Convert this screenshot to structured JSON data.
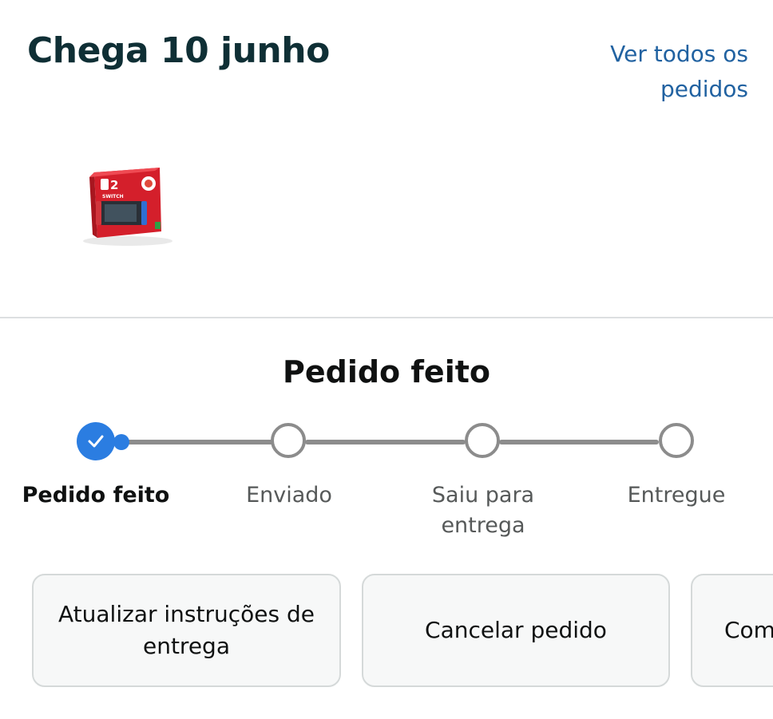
{
  "header": {
    "arrival_title": "Chega 10 junho",
    "view_all_orders": "Ver todos os pedidos"
  },
  "product": {
    "badge_text": "2",
    "brand_text": "SWITCH"
  },
  "status": {
    "title": "Pedido feito",
    "steps": [
      {
        "label": "Pedido feito",
        "state": "done"
      },
      {
        "label": "Enviado",
        "state": "pending"
      },
      {
        "label": "Saiu para entrega",
        "state": "pending"
      },
      {
        "label": "Entregue",
        "state": "pending"
      }
    ]
  },
  "actions": [
    {
      "label": "Atualizar instruções de entrega"
    },
    {
      "label": "Cancelar pedido"
    },
    {
      "label": "Com"
    }
  ],
  "colors": {
    "title": "#0f2f35",
    "link": "#2162a1",
    "accent": "#2b7de1",
    "track": "#8c8c8c",
    "product_box": "#d41f2b"
  },
  "icons": {
    "done_step": "check-icon"
  }
}
